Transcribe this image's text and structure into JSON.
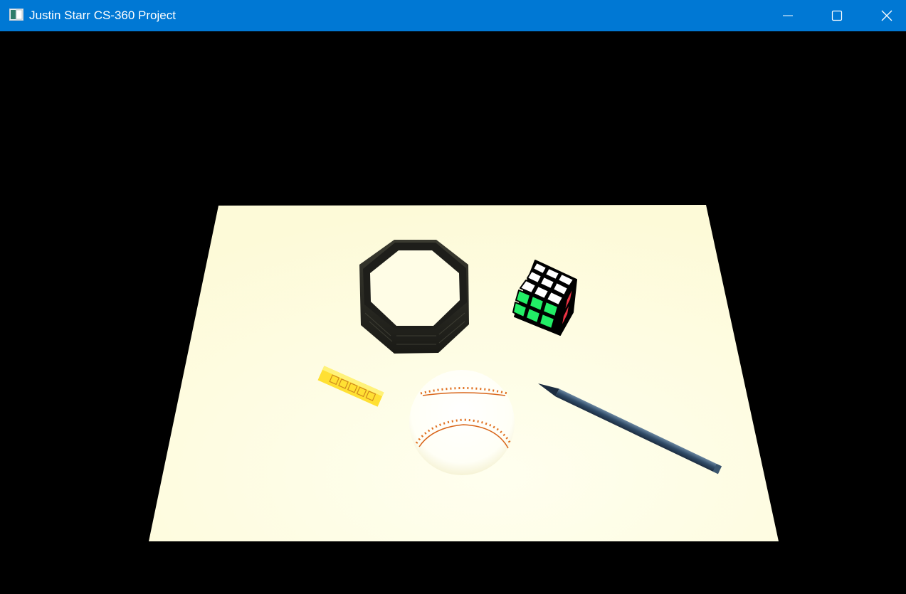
{
  "window": {
    "title": "Justin Starr CS-360 Project",
    "titlebar_color": "#0078d4",
    "controls": {
      "minimize_icon": "minimize-icon",
      "maximize_icon": "maximize-icon",
      "close_icon": "close-icon"
    }
  },
  "scene": {
    "background_color": "#000000",
    "objects": [
      "paper-plane",
      "octagonal-holder",
      "rubiks-cube",
      "yellow-eraser",
      "baseball",
      "pencil"
    ],
    "colors": {
      "paper": "#fffde0",
      "cube_white": "#ffffff",
      "cube_green": "#22ee66",
      "cube_red": "#ee3344",
      "eraser": "#ffe033",
      "baseball_stitch": "#e07020",
      "pencil": "#2e4a66"
    }
  }
}
